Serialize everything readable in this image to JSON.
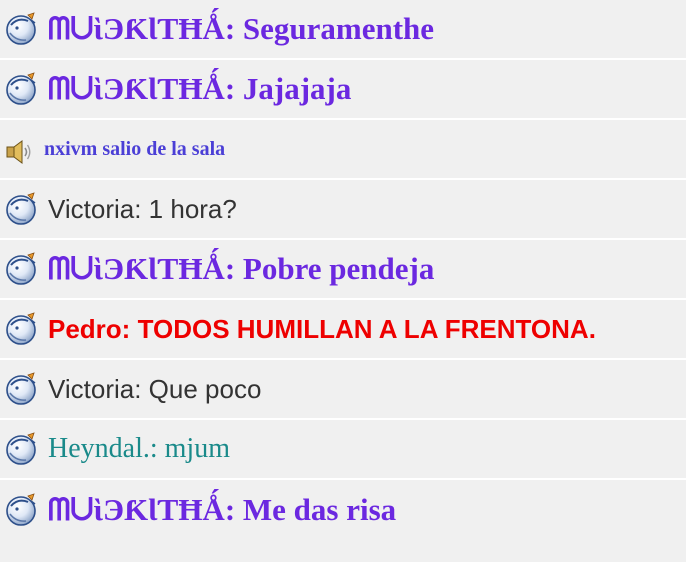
{
  "colors": {
    "row_bg": "#f0f0f0",
    "row_separator": "#ffffff",
    "purple_name": "#6b28e0",
    "system_text": "#4b3fd6",
    "dark_text": "#333333",
    "red_text": "#ee0000",
    "teal_text": "#1a8a8a"
  },
  "icons": {
    "avatar": "round-bubble-avatar-icon",
    "system": "speaker-icon"
  },
  "messages": [
    {
      "style": "serif-purple",
      "icon": "avatar",
      "text": "ᗰᑌὶЭƘƖƬĦǺ: Seguramenthe"
    },
    {
      "style": "serif-purple",
      "icon": "avatar",
      "text": "ᗰᑌὶЭƘƖƬĦǺ: Jajajaja"
    },
    {
      "style": "system",
      "icon": "speaker",
      "text": "nxivm salio de la sala"
    },
    {
      "style": "sans-dark",
      "icon": "avatar",
      "text": "Victoria: 1 hora?"
    },
    {
      "style": "serif-purple",
      "icon": "avatar",
      "text": "ᗰᑌὶЭƘƖƬĦǺ: Pobre pendeja"
    },
    {
      "style": "sans-red",
      "icon": "avatar",
      "text": "Pedro: TODOS HUMILLAN A LA FRENTONA."
    },
    {
      "style": "sans-dark",
      "icon": "avatar",
      "text": "Victoria: Que poco"
    },
    {
      "style": "serif-teal",
      "icon": "avatar",
      "text": "Heyndal.: mjum"
    },
    {
      "style": "serif-purple",
      "icon": "avatar",
      "text": "ᗰᑌὶЭƘƖƬĦǺ: Me das risa"
    }
  ]
}
